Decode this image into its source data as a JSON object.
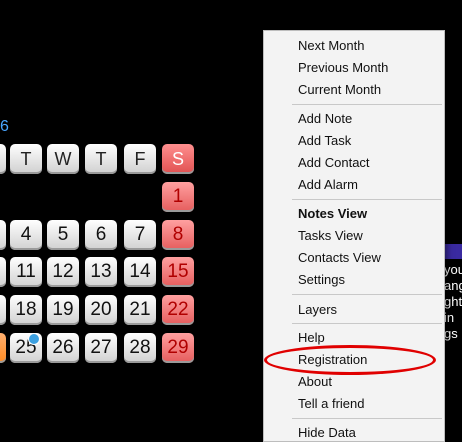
{
  "calendar": {
    "month_fragment": "6",
    "day_headers": [
      "T",
      "W",
      "T",
      "F",
      "S"
    ],
    "days": {
      "row1": [
        "1"
      ],
      "row2": [
        "4",
        "5",
        "6",
        "7",
        "8"
      ],
      "row3": [
        "11",
        "12",
        "13",
        "14",
        "15"
      ],
      "row4": [
        "18",
        "19",
        "20",
        "21",
        "22"
      ],
      "row5": [
        "25",
        "26",
        "27",
        "28",
        "29"
      ]
    }
  },
  "side_text": [
    "you",
    "ang",
    "ght",
    "in",
    "gs"
  ],
  "menu": {
    "items": [
      "Next Month",
      "Previous Month",
      "Current Month",
      "Add Note",
      "Add Task",
      "Add Contact",
      "Add Alarm",
      "Notes View",
      "Tasks View",
      "Contacts View",
      "Settings",
      "Layers",
      "Help",
      "Registration",
      "About",
      "Tell a friend",
      "Hide Data"
    ]
  },
  "colors": {
    "weekend": "#e55c5c",
    "highlight_ellipse": "#e00000",
    "menu_bg": "#f3f3f3"
  }
}
